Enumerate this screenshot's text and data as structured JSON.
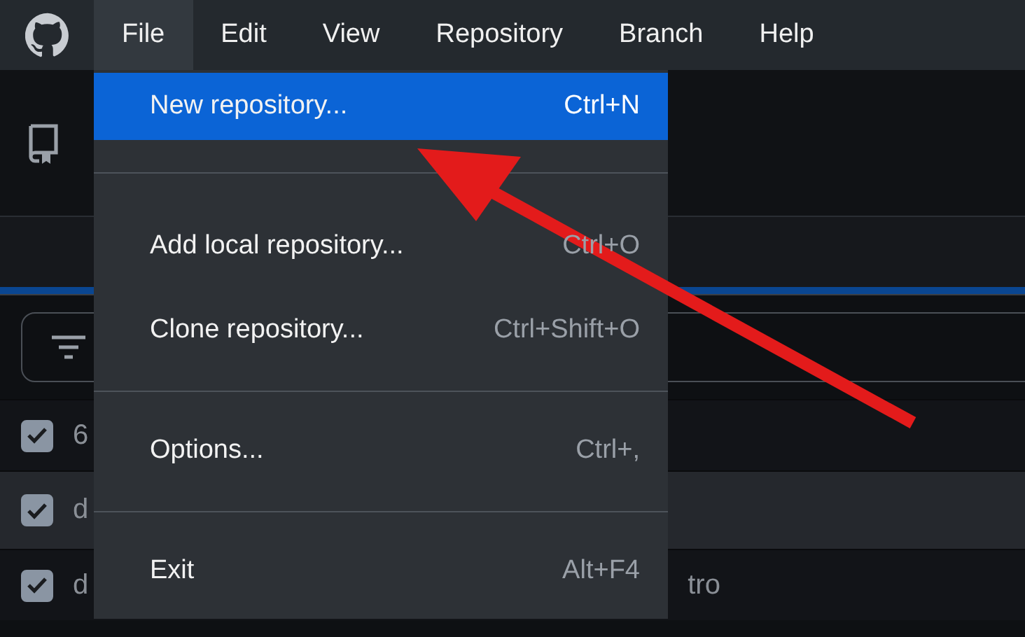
{
  "menu_bar": {
    "items": [
      {
        "label": "File",
        "selected": true
      },
      {
        "label": "Edit",
        "selected": false
      },
      {
        "label": "View",
        "selected": false
      },
      {
        "label": "Repository",
        "selected": false
      },
      {
        "label": "Branch",
        "selected": false
      },
      {
        "label": "Help",
        "selected": false
      }
    ]
  },
  "file_menu": {
    "items": [
      {
        "kind": "item",
        "label": "New repository...",
        "shortcut": "Ctrl+N",
        "selected": true
      },
      {
        "kind": "separator"
      },
      {
        "kind": "item",
        "label": "Add local repository...",
        "shortcut": "Ctrl+O",
        "selected": false
      },
      {
        "kind": "item",
        "label": "Clone repository...",
        "shortcut": "Ctrl+Shift+O",
        "selected": false
      },
      {
        "kind": "separator"
      },
      {
        "kind": "item",
        "label": "Options...",
        "shortcut": "Ctrl+,",
        "selected": false
      },
      {
        "kind": "separator"
      },
      {
        "kind": "item",
        "label": "Exit",
        "shortcut": "Alt+F4",
        "selected": false
      }
    ]
  },
  "changes": {
    "rows": [
      {
        "checked": true,
        "text": "6",
        "highlighted": false
      },
      {
        "checked": true,
        "text": "d",
        "highlighted": true
      },
      {
        "checked": true,
        "text": "d",
        "tail": "tro",
        "highlighted": false
      }
    ]
  }
}
